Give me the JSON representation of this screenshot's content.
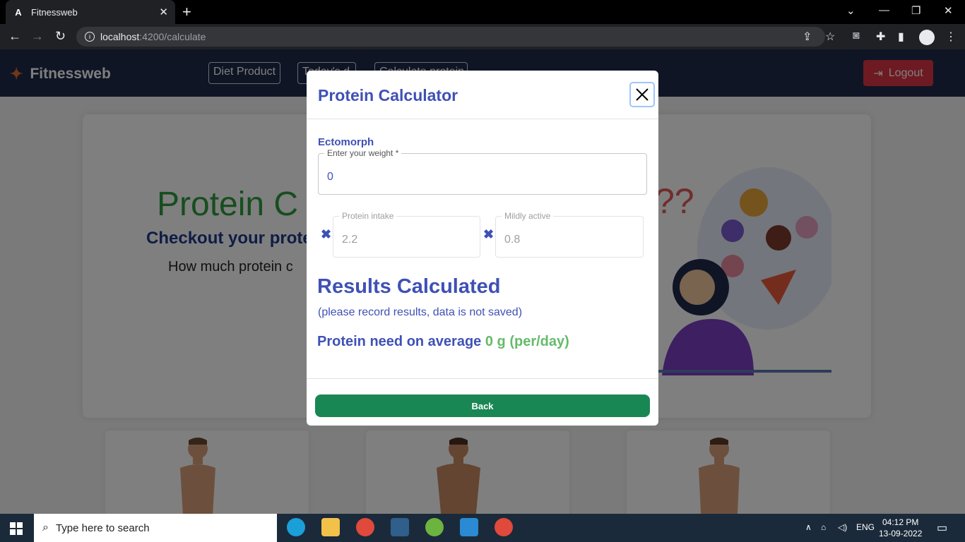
{
  "browser": {
    "tab_title": "Fitnessweb",
    "tab_favicon": "A",
    "url_host": "localhost",
    "url_path": ":4200/calculate"
  },
  "app": {
    "brand": "Fitnessweb",
    "nav": [
      "Diet Product",
      "Today's d",
      "Calculate protein"
    ],
    "logout": "Logout"
  },
  "page": {
    "hero_title": "Protein C",
    "hero_subtitle": "Checkout your prote",
    "hero_text": "How much protein c"
  },
  "modal": {
    "title": "Protein Calculator",
    "body_type": "Ectomorph",
    "weight_label": "Enter your weight *",
    "weight_value": "0",
    "protein_intake_label": "Protein intake",
    "protein_intake_value": "2.2",
    "activity_label": "Mildly active",
    "activity_value": "0.8",
    "results_title": "Results Calculated",
    "results_note": "(please record results, data is not saved)",
    "protein_need_label": "Protein need on average",
    "protein_need_value": "0 g (per/day)",
    "back_button": "Back"
  },
  "taskbar": {
    "search_placeholder": "Type here to search",
    "language": "ENG",
    "time": "04:12 PM",
    "date": "13-09-2022"
  },
  "colors": {
    "primary": "#3f51b5",
    "success": "#198754",
    "danger": "#dc3545",
    "accent_green": "#66bb6a"
  }
}
